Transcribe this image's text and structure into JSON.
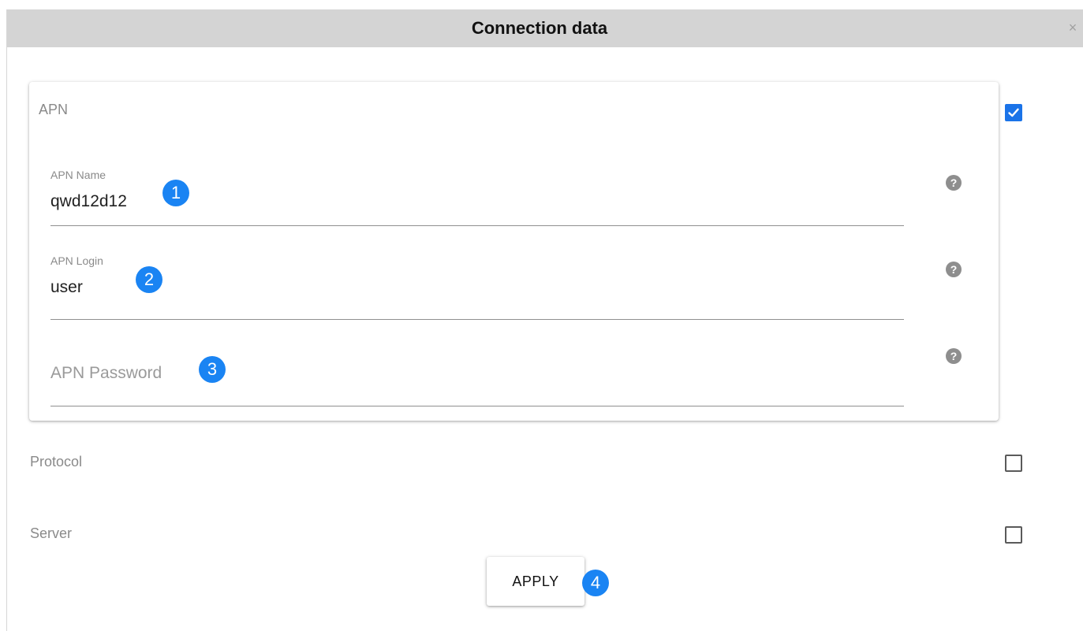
{
  "dialog": {
    "title": "Connection data",
    "close_icon": "close-icon",
    "close_glyph": "×"
  },
  "apn": {
    "label": "APN",
    "enabled": true,
    "fields": [
      {
        "label": "APN Name",
        "value": "qwd12d12",
        "badge": "1"
      },
      {
        "label": "APN Login",
        "value": "user",
        "badge": "2"
      },
      {
        "label": "",
        "value": "",
        "placeholder": "APN Password",
        "badge": "3"
      }
    ],
    "help_glyph": "?"
  },
  "protocol": {
    "label": "Protocol",
    "enabled": false
  },
  "server": {
    "label": "Server",
    "enabled": false
  },
  "apply": {
    "label": "APPLY",
    "badge": "4"
  },
  "colors": {
    "accent": "#1a73e8",
    "badge": "#1a84f3",
    "titlebar": "#d4d4d4"
  }
}
